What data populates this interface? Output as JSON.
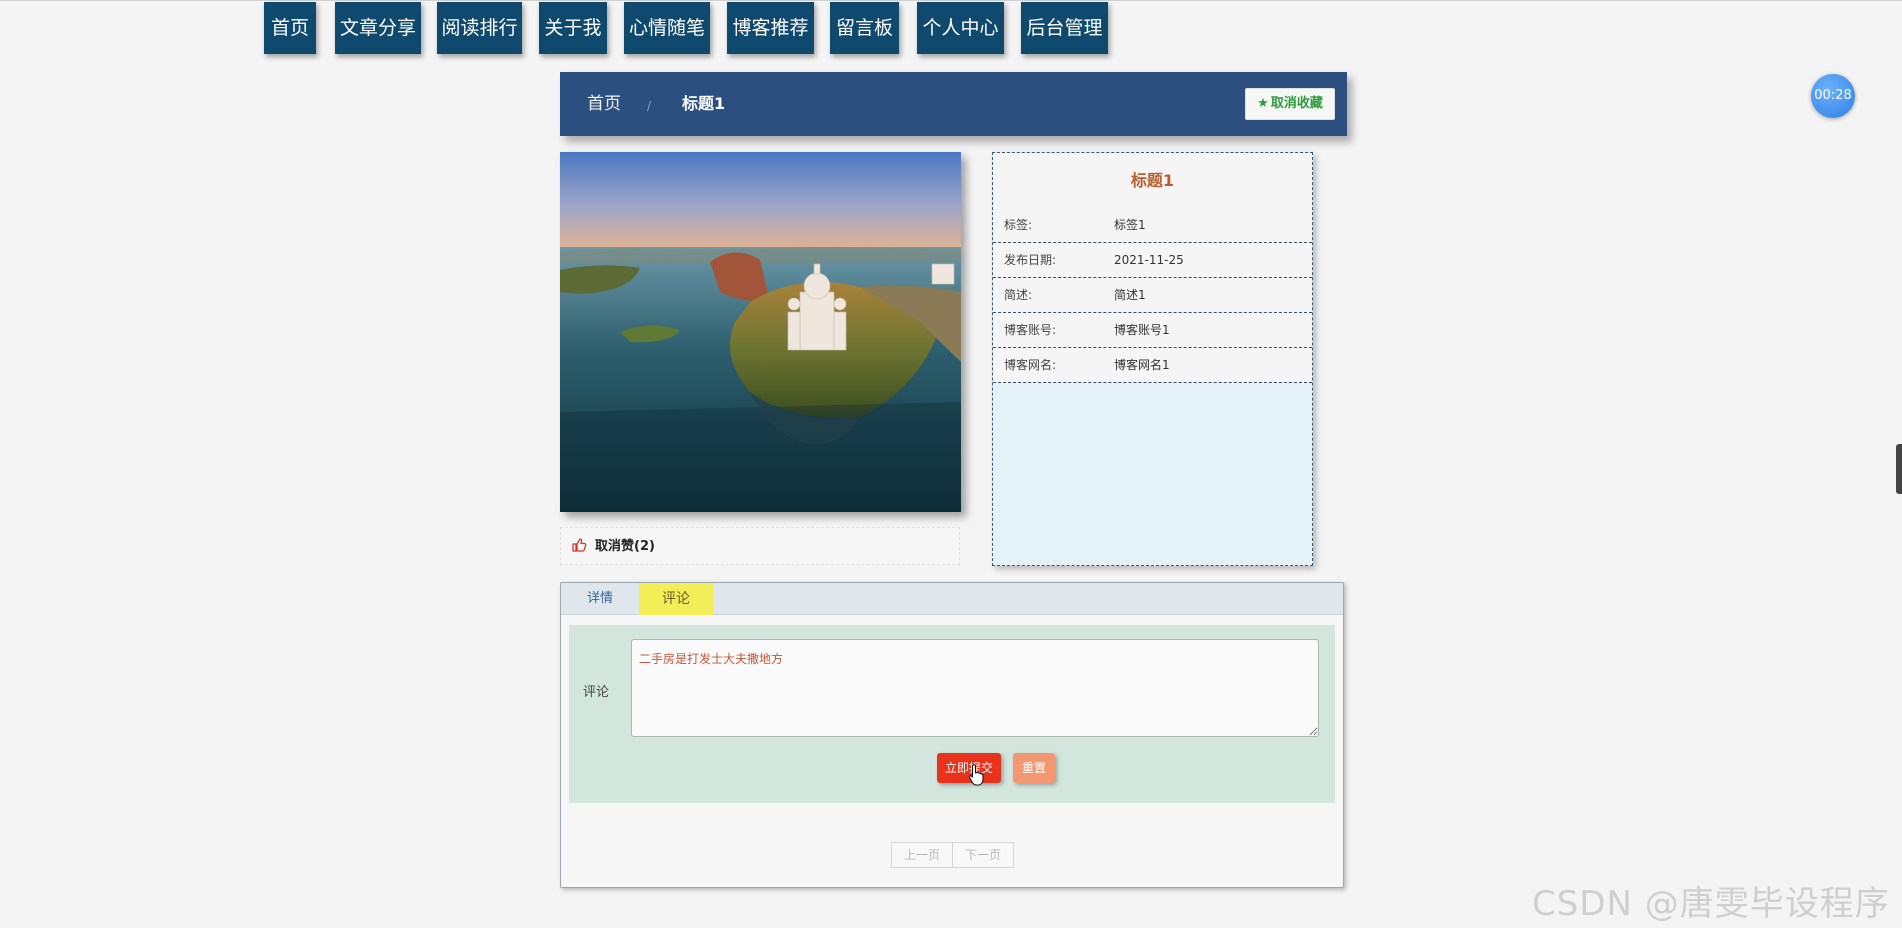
{
  "nav": {
    "items": [
      "首页",
      "文章分享",
      "阅读排行",
      "关于我",
      "心情随笔",
      "博客推荐",
      "留言板",
      "个人中心",
      "后台管理"
    ]
  },
  "breadcrumb": {
    "home": "首页",
    "separator": "/",
    "current": "标题1",
    "favorite_label": "取消收藏"
  },
  "like": {
    "label": "取消赞(2)"
  },
  "info": {
    "title": "标题1",
    "rows": [
      {
        "key": "标签:",
        "value": "标签1"
      },
      {
        "key": "发布日期:",
        "value": "2021-11-25"
      },
      {
        "key": "简述:",
        "value": "简述1"
      },
      {
        "key": "博客账号:",
        "value": "博客账号1"
      },
      {
        "key": "博客网名:",
        "value": "博客网名1"
      }
    ]
  },
  "tabs": {
    "detail": "详情",
    "comment": "评论"
  },
  "comment_form": {
    "label": "评论",
    "value": "二手房是打发士大夫撒地方",
    "submit": "立即提交",
    "reset": "重置"
  },
  "pager": {
    "prev": "上一页",
    "next": "下一页"
  },
  "timer": "00:28",
  "watermark": "CSDN @唐雯毕设程序",
  "colors": {
    "nav_bg": "#0f4a6e",
    "breadcrumb_bg": "#2b4f7f",
    "favorite_green": "#2f9b3e",
    "title_orange": "#b85f2c",
    "submit_red": "#e8321c",
    "reset_orange": "#f29770",
    "active_tab_yellow": "#f2ee58",
    "form_bg": "#d3e6de"
  }
}
